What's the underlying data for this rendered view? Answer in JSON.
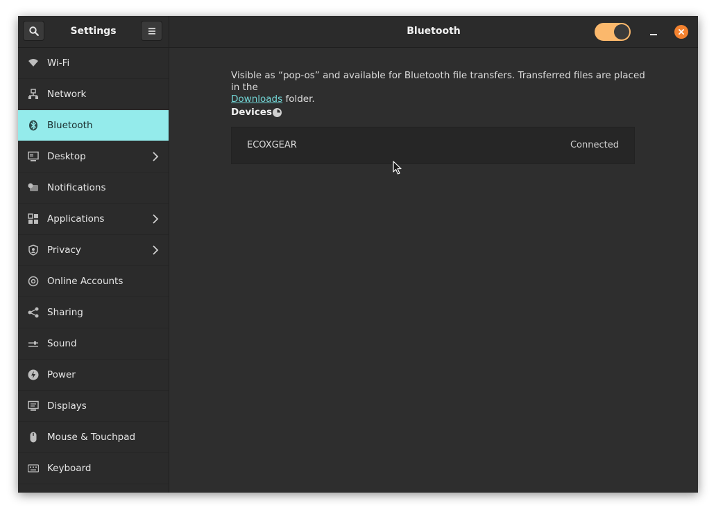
{
  "sidebar_header": {
    "title": "Settings"
  },
  "main_header": {
    "title": "Bluetooth",
    "bluetooth_enabled": true
  },
  "colors": {
    "accent": "#94ebeb",
    "toggle_on": "#fbb86c",
    "close": "#f4822f",
    "link": "#73d7d7"
  },
  "sidebar": {
    "items": [
      {
        "label": "Wi-Fi",
        "icon": "wifi-icon"
      },
      {
        "label": "Network",
        "icon": "network-icon"
      },
      {
        "label": "Bluetooth",
        "icon": "bluetooth-icon",
        "active": true
      },
      {
        "label": "Desktop",
        "icon": "desktop-icon",
        "has_submenu": true
      },
      {
        "label": "Notifications",
        "icon": "notifications-icon"
      },
      {
        "label": "Applications",
        "icon": "applications-icon",
        "has_submenu": true
      },
      {
        "label": "Privacy",
        "icon": "privacy-icon",
        "has_submenu": true
      },
      {
        "label": "Online Accounts",
        "icon": "at-sign-icon"
      },
      {
        "label": "Sharing",
        "icon": "share-icon"
      },
      {
        "label": "Sound",
        "icon": "sound-icon"
      },
      {
        "label": "Power",
        "icon": "power-icon"
      },
      {
        "label": "Displays",
        "icon": "displays-icon"
      },
      {
        "label": "Mouse & Touchpad",
        "icon": "mouse-icon"
      },
      {
        "label": "Keyboard",
        "icon": "keyboard-icon"
      }
    ]
  },
  "main": {
    "description_pre": "Visible as “pop-os” and available for Bluetooth file transfers. Transferred files are placed in the",
    "description_link": "Downloads",
    "description_post": "folder.",
    "devices_label": "Devices",
    "devices": [
      {
        "name": "ECOXGEAR",
        "status": "Connected"
      }
    ]
  }
}
